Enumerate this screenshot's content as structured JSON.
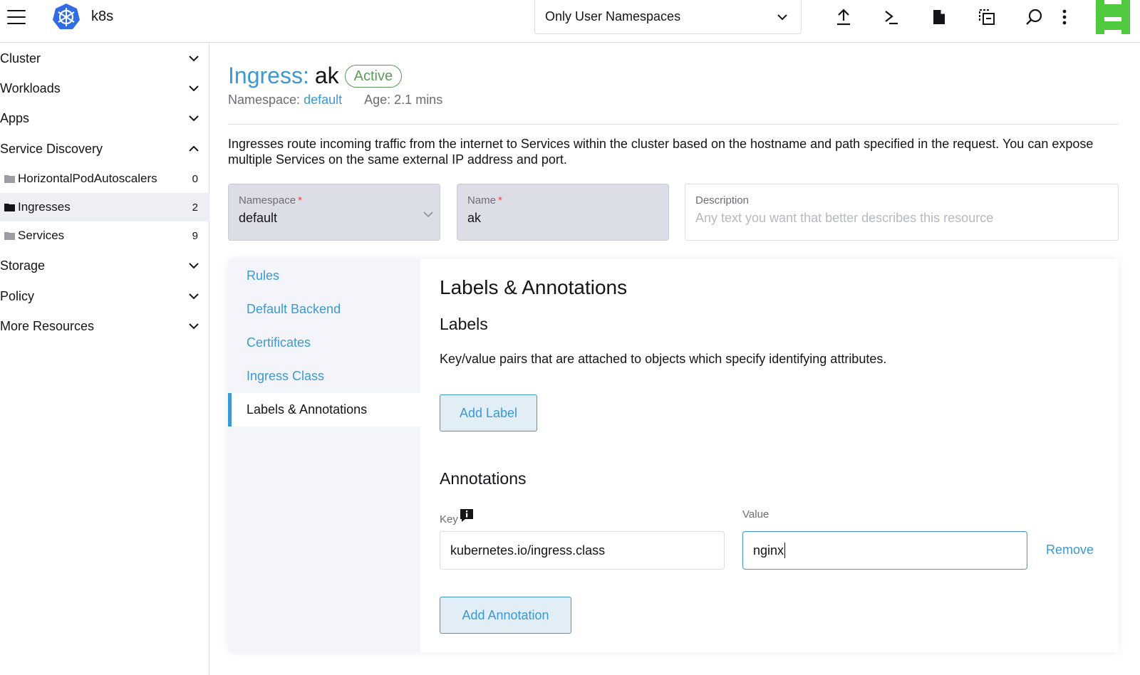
{
  "header": {
    "cluster_name": "k8s",
    "namespace_filter": "Only User Namespaces",
    "icons": [
      "menu-icon",
      "upload-icon",
      "terminal-icon",
      "file-icon",
      "copy-config-icon",
      "search-icon",
      "more-vertical-icon"
    ]
  },
  "sidebar": {
    "groups": [
      {
        "label": "Cluster",
        "expanded": false
      },
      {
        "label": "Workloads",
        "expanded": false
      },
      {
        "label": "Apps",
        "expanded": false
      },
      {
        "label": "Service Discovery",
        "expanded": true
      },
      {
        "label": "Storage",
        "expanded": false
      },
      {
        "label": "Policy",
        "expanded": false
      },
      {
        "label": "More Resources",
        "expanded": false
      }
    ],
    "items": [
      {
        "label": "HorizontalPodAutoscalers",
        "count": "0"
      },
      {
        "label": "Ingresses",
        "count": "2",
        "active": true
      },
      {
        "label": "Services",
        "count": "9"
      }
    ]
  },
  "page": {
    "type_label": "Ingress:",
    "resource_name": "ak",
    "status": "Active",
    "namespace_label": "Namespace:",
    "namespace_value": "default",
    "age": "Age: 2.1 mins",
    "description": "Ingresses route incoming traffic from the internet to Services within the cluster based on the hostname and path specified in the request. You can expose multiple Services on the same external IP address and port."
  },
  "form": {
    "namespace": {
      "label": "Namespace",
      "value": "default"
    },
    "name": {
      "label": "Name",
      "value": "ak"
    },
    "description": {
      "label": "Description",
      "placeholder": "Any text you want that better describes this resource"
    }
  },
  "tabs": [
    "Rules",
    "Default Backend",
    "Certificates",
    "Ingress Class",
    "Labels & Annotations"
  ],
  "active_tab": "Labels & Annotations",
  "panel": {
    "title": "Labels & Annotations",
    "labels_heading": "Labels",
    "labels_help": "Key/value pairs that are attached to objects which specify identifying attributes.",
    "add_label": "Add Label",
    "annotations_heading": "Annotations",
    "key_label": "Key",
    "value_label": "Value",
    "annotation_key": "kubernetes.io/ingress.class",
    "annotation_value": "nginx",
    "remove": "Remove",
    "add_annotation": "Add Annotation"
  },
  "colors": {
    "link": "#3d98d3",
    "active_badge": "#5d995d",
    "required": "#f64747",
    "avatar": "#4fc93d"
  }
}
